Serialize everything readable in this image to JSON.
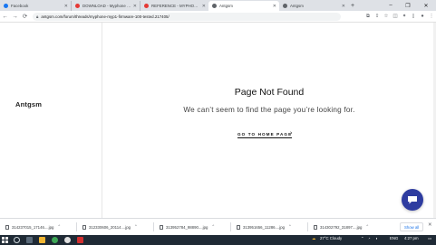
{
  "browser": {
    "tabs": [
      {
        "title": "Facebook",
        "favicon_color": "#1877f2",
        "active": false
      },
      {
        "title": "DOWNLOAD - Myphone Myp",
        "favicon_color": "#e53935",
        "active": false
      },
      {
        "title": "REFERENCE - MYPHONE MYP",
        "favicon_color": "#e53935",
        "active": false
      },
      {
        "title": "Antgsm",
        "favicon_color": "#5f6368",
        "active": true
      },
      {
        "title": "Antgsm",
        "favicon_color": "#5f6368",
        "active": false
      }
    ],
    "url": "antgsm.com/forum/threads/myphone-myp1-firmware-100-tested.217405/"
  },
  "site": {
    "logo": "Antgsm",
    "not_found_title": "Page Not Found",
    "not_found_message": "We can’t seem to find the page you’re looking for.",
    "home_link": "GO TO HOME PAGE",
    "chat_color": "#2e3ca0"
  },
  "downloads": {
    "items": [
      {
        "name": "314237015_17146....jpg"
      },
      {
        "name": "312330606_20114....jpg"
      },
      {
        "name": "313952784_98890....jpg"
      },
      {
        "name": "313951656_11286....jpg"
      },
      {
        "name": "314302792_31897....jpg"
      }
    ],
    "show_all": "Show all"
  },
  "taskbar": {
    "weather": "27°C  Cloudy",
    "language": "ENG",
    "time": "4:27 pm"
  }
}
